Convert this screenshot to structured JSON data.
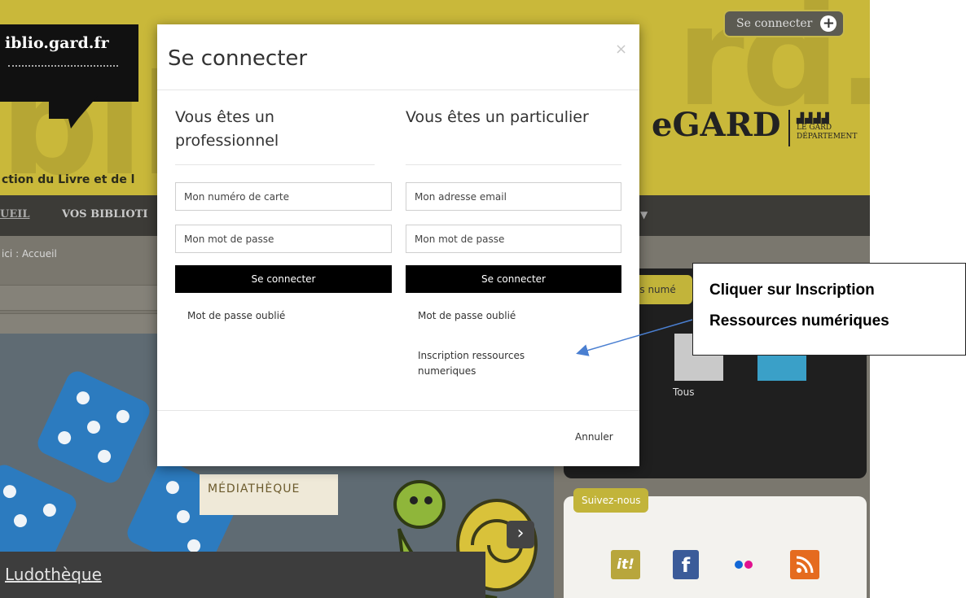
{
  "site": {
    "logo": "iblio.gard.fr",
    "subtitle": "ction du Livre et de l",
    "brand": "GARD",
    "brand_prefix": "e",
    "brand_sub_line1": "LE GARD",
    "brand_sub_line2": "DÉPARTEMENT",
    "header_connect": "Se connecter",
    "nav": [
      "UEIL",
      "VOS BIBLIOTI"
    ],
    "breadcrumb": "ici : Accueil",
    "resources_tab": "es numé",
    "thumb_label": "Tous",
    "carousel_badge": "MÉDIATHÈQUE",
    "carousel_caption": "Ludothèque",
    "follow_tab": "Suivez-nous",
    "social": [
      "it!",
      "facebook-icon",
      "flickr-icon",
      "rss-icon"
    ]
  },
  "modal": {
    "title": "Se connecter",
    "close": "×",
    "professional": {
      "heading": "Vous êtes un professionnel",
      "card_placeholder": "Mon numéro de carte",
      "password_placeholder": "Mon mot de passe",
      "submit": "Se connecter",
      "forgot": "Mot de passe oublié"
    },
    "individual": {
      "heading": "Vous êtes un particulier",
      "email_placeholder": "Mon adresse email",
      "password_placeholder": "Mon mot de passe",
      "submit": "Se connecter",
      "forgot": "Mot de passe oublié",
      "register": "Inscription ressources numeriques"
    },
    "cancel": "Annuler"
  },
  "callout": {
    "line1": "Cliquer sur Inscription",
    "line2": "Ressources numériques"
  },
  "colors": {
    "banner": "#c9b83a",
    "nav": "#3c3b37",
    "arrow": "#4a7fd1"
  }
}
